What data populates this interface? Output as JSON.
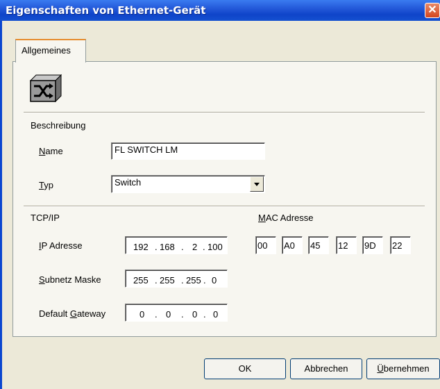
{
  "window": {
    "title": "Eigenschaften von Ethernet-Gerät",
    "close_glyph": "✕"
  },
  "tabs": [
    {
      "label": "Allgemeines",
      "active": true
    }
  ],
  "device_icon": "switch-device-icon",
  "beschreibung": {
    "section_label": "Beschreibung",
    "name": {
      "mnemonic": "N",
      "rest": "ame",
      "value": "FL SWITCH LM"
    },
    "typ": {
      "mnemonic": "T",
      "rest": "yp",
      "value": "Switch"
    }
  },
  "tcpip": {
    "section_label": "TCP/IP",
    "ip": {
      "mnemonic": "I",
      "rest": "P Adresse",
      "octets": [
        "192",
        "168",
        "2",
        "100"
      ]
    },
    "subnet": {
      "mnemonic": "S",
      "rest": "ubnetz Maske",
      "octets": [
        "255",
        "255",
        "255",
        "0"
      ]
    },
    "gateway": {
      "prefix": "Default ",
      "mnemonic": "G",
      "rest": "ateway",
      "octets": [
        "0",
        "0",
        "0",
        "0"
      ]
    }
  },
  "mac": {
    "mnemonic": "M",
    "rest": "AC Adresse",
    "bytes": [
      "00",
      "A0",
      "45",
      "12",
      "9D",
      "22"
    ]
  },
  "buttons": {
    "ok": "OK",
    "cancel": "Abbrechen",
    "apply_mnemonic": "Ü",
    "apply_rest": "bernehmen"
  },
  "colors": {
    "titlebar": "#0f44c9",
    "face": "#ece9d8",
    "panel": "#f7f6f0",
    "tab_highlight": "#e68b2c"
  }
}
